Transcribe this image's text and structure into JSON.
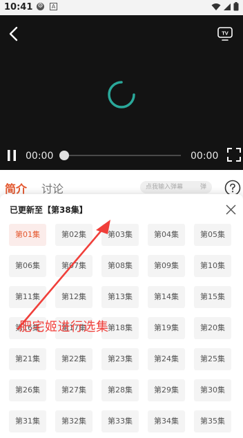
{
  "status_bar": {
    "time": "10:41",
    "icons": [
      "shield-status-icon",
      "a-badge-icon",
      "wifi-icon",
      "signal-icon",
      "battery-icon"
    ],
    "glyph_1": "⚙",
    "glyph_2": "A"
  },
  "player": {
    "current_time": "00:00",
    "total_time": "00:00",
    "progress": 0,
    "accent_color": "#2aa89a",
    "tv_label": "TV"
  },
  "tabs": {
    "intro": "简介",
    "discuss": "讨论",
    "danmaku_placeholder": "点我输入弹幕",
    "danmaku_send": "弹"
  },
  "episode_sheet": {
    "title": "已更新至【第38集】",
    "selected_index": 0,
    "episodes": [
      "第01集",
      "第02集",
      "第03集",
      "第04集",
      "第05集",
      "第06集",
      "第07集",
      "第08集",
      "第09集",
      "第10集",
      "第11集",
      "第12集",
      "第13集",
      "第14集",
      "第15集",
      "第16集",
      "第17集",
      "第18集",
      "第19集",
      "第20集",
      "第21集",
      "第22集",
      "第23集",
      "第24集",
      "第25集",
      "第26集",
      "第27集",
      "第28集",
      "第29集",
      "第30集",
      "第31集",
      "第32集",
      "第33集",
      "第34集",
      "第35集"
    ]
  },
  "annotation": {
    "text": "肥宅姬进行选集",
    "color": "#f03f3a"
  }
}
